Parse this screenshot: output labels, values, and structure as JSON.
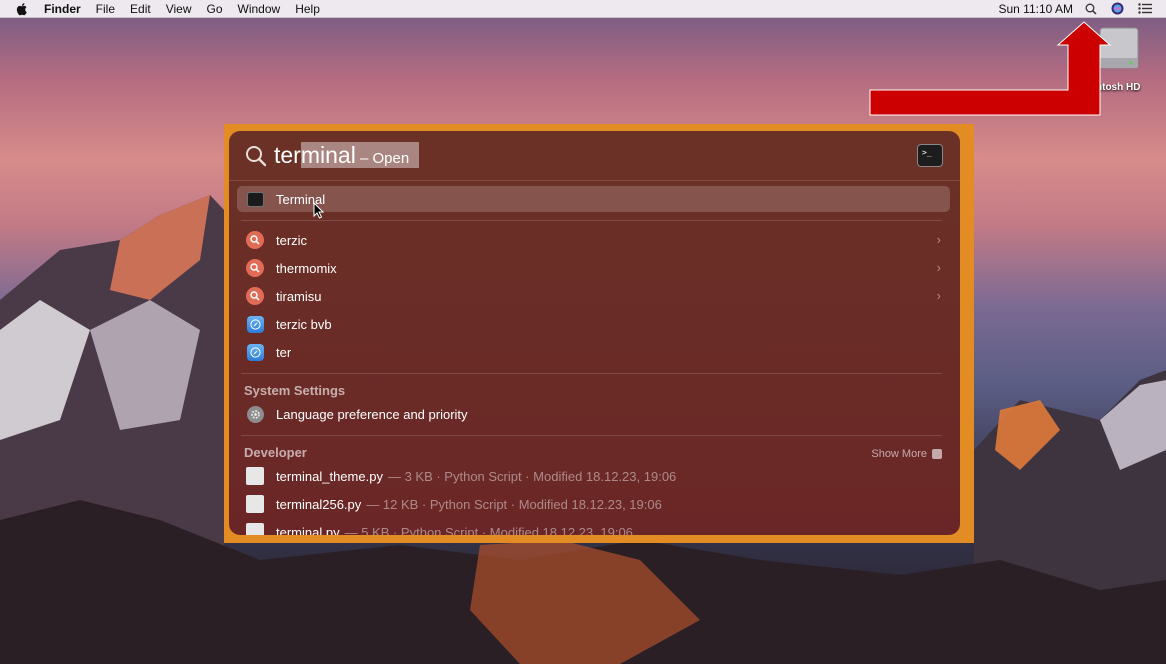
{
  "menubar": {
    "app_name": "Finder",
    "items": [
      "File",
      "Edit",
      "View",
      "Go",
      "Window",
      "Help"
    ],
    "clock": "Sun 11:10 AM"
  },
  "desktop": {
    "disk_label": "ntosh HD"
  },
  "spotlight": {
    "query_prefix": "ter",
    "query_completion": "minal",
    "query_hint": " – Open",
    "top_hit": {
      "label": "Terminal",
      "icon": "terminal-icon"
    },
    "suggestions": [
      {
        "label": "terzic",
        "icon": "search-suggestion-icon"
      },
      {
        "label": "thermomix",
        "icon": "search-suggestion-icon"
      },
      {
        "label": "tiramisu",
        "icon": "search-suggestion-icon"
      },
      {
        "label": "terzic bvb",
        "icon": "safari-icon"
      },
      {
        "label": "ter",
        "icon": "safari-icon"
      }
    ],
    "system_settings": {
      "title": "System Settings",
      "items": [
        {
          "label": "Language preference and priority",
          "icon": "settings-icon"
        }
      ]
    },
    "developer": {
      "title": "Developer",
      "show_more": "Show More",
      "items": [
        {
          "label": "terminal_theme.py",
          "meta": "— 3 KB · Python Script · Modified 18.12.23, 19:06"
        },
        {
          "label": "terminal256.py",
          "meta": "— 12 KB · Python Script · Modified 18.12.23, 19:06"
        },
        {
          "label": "terminal.py",
          "meta": "— 5 KB · Python Script · Modified 18.12.23, 19:06"
        }
      ]
    }
  },
  "colors": {
    "annotation_arrow": "#cc0000",
    "spotlight_frame": "#e48c24"
  }
}
